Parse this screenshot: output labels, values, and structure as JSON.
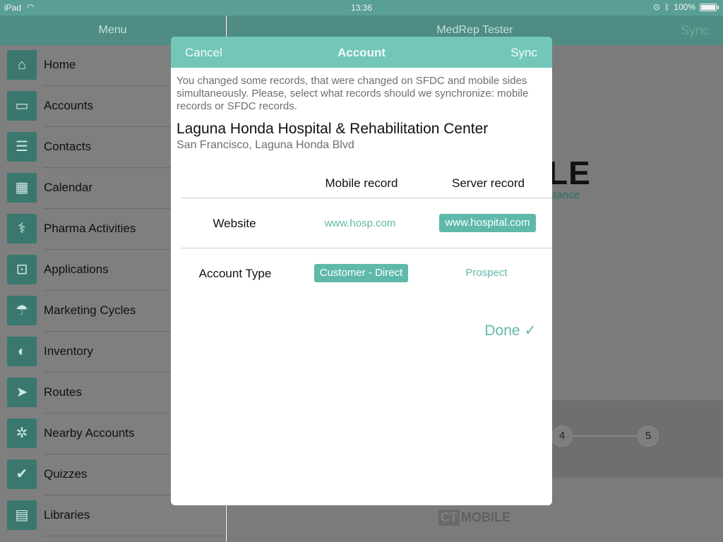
{
  "status_bar": {
    "carrier": "iPad",
    "time": "13:36",
    "battery": "100%"
  },
  "sidebar": {
    "title": "Menu",
    "items": [
      {
        "label": "Home",
        "icon": "home-icon"
      },
      {
        "label": "Accounts",
        "icon": "folder-icon"
      },
      {
        "label": "Contacts",
        "icon": "contacts-icon"
      },
      {
        "label": "Calendar",
        "icon": "calendar-icon"
      },
      {
        "label": "Pharma Activities",
        "icon": "pharma-icon"
      },
      {
        "label": "Applications",
        "icon": "presentation-icon"
      },
      {
        "label": "Marketing Cycles",
        "icon": "beach-icon"
      },
      {
        "label": "Inventory",
        "icon": "inventory-icon"
      },
      {
        "label": "Routes",
        "icon": "navigation-icon"
      },
      {
        "label": "Nearby Accounts",
        "icon": "network-icon"
      },
      {
        "label": "Quizzes",
        "icon": "checkmark-icon"
      },
      {
        "label": "Libraries",
        "icon": "library-icon"
      }
    ]
  },
  "main": {
    "title": "MedRep Tester",
    "sync_label": "Sync",
    "background_logo": "LE",
    "background_subtitle": "stance",
    "steps": [
      "4",
      "5"
    ],
    "footer_logo_prefix": "CT",
    "footer_logo": "MOBILE"
  },
  "modal": {
    "cancel_label": "Cancel",
    "title": "Account",
    "sync_label": "Sync",
    "message": "You changed some records, that were changed on SFDC and mobile sides simultaneously. Please, select what records  should we synchronize: mobile records or SFDC records.",
    "account_name": "Laguna Honda Hospital & Rehabilitation Center",
    "account_address": "San Francisco, Laguna Honda Blvd",
    "col_mobile": "Mobile record",
    "col_server": "Server record",
    "rows": [
      {
        "label": "Website",
        "mobile": "www.hosp.com",
        "server": "www.hospital.com",
        "selected": "server"
      },
      {
        "label": "Account Type",
        "mobile": "Customer - Direct",
        "server": "Prospect",
        "selected": "mobile"
      }
    ],
    "done_label": "Done ✓"
  },
  "colors": {
    "accent": "#5fb9aa",
    "header": "#72c7b9"
  }
}
